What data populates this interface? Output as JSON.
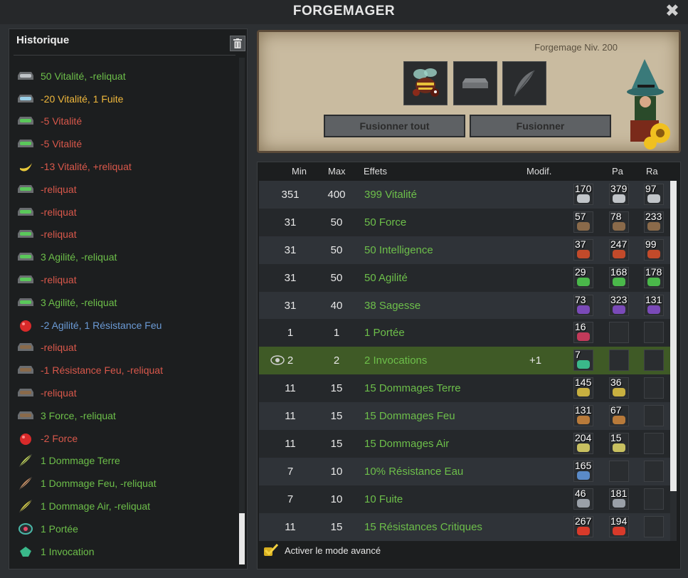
{
  "window": {
    "title": "FORGEMAGER",
    "close_label": "✖"
  },
  "history": {
    "title": "Historique",
    "items": [
      {
        "text": "50 Vitalité, -reliquat",
        "color": "green",
        "icon": "gray-rune-icon"
      },
      {
        "text": "-20 Vitalité, 1 Fuite",
        "color": "orange",
        "icon": "blue-rune-icon"
      },
      {
        "text": "-5 Vitalité",
        "color": "red",
        "icon": "green-rune-icon"
      },
      {
        "text": "-5 Vitalité",
        "color": "red",
        "icon": "green-rune-icon"
      },
      {
        "text": "-13 Vitalité, +reliquat",
        "color": "red",
        "icon": "banana-rune-icon"
      },
      {
        "text": "-reliquat",
        "color": "red",
        "icon": "green-rune-icon"
      },
      {
        "text": "-reliquat",
        "color": "red",
        "icon": "green-rune-icon"
      },
      {
        "text": "-reliquat",
        "color": "red",
        "icon": "green-rune-icon"
      },
      {
        "text": "3 Agilité, -reliquat",
        "color": "green",
        "icon": "green-rune-icon"
      },
      {
        "text": "-reliquat",
        "color": "red",
        "icon": "green-rune-icon"
      },
      {
        "text": "3 Agilité, -reliquat",
        "color": "green",
        "icon": "green-rune-icon"
      },
      {
        "text": "-2 Agilité, 1 Résistance Feu",
        "color": "blue",
        "icon": "red-rune-icon"
      },
      {
        "text": "-reliquat",
        "color": "red",
        "icon": "brown-rune-icon"
      },
      {
        "text": "-1 Résistance Feu, -reliquat",
        "color": "red",
        "icon": "brown-rune-icon"
      },
      {
        "text": "-reliquat",
        "color": "red",
        "icon": "brown-rune-icon"
      },
      {
        "text": "3 Force, -reliquat",
        "color": "green",
        "icon": "brown-rune-icon"
      },
      {
        "text": "-2 Force",
        "color": "red",
        "icon": "red-rune-icon"
      },
      {
        "text": "1 Dommage Terre",
        "color": "green",
        "icon": "quill-green-icon"
      },
      {
        "text": "1 Dommage Feu, -reliquat",
        "color": "green",
        "icon": "quill-brown-icon"
      },
      {
        "text": "1 Dommage Air, -reliquat",
        "color": "green",
        "icon": "quill-yellow-icon"
      },
      {
        "text": "1 Portée",
        "color": "green",
        "icon": "eye-rune-icon"
      },
      {
        "text": "1 Invocation",
        "color": "green",
        "icon": "invoc-rune-icon"
      }
    ]
  },
  "forge": {
    "level_text": "Forgemage Niv. 200",
    "fuse_all_label": "Fusionner tout",
    "fuse_label": "Fusionner"
  },
  "table": {
    "headers": {
      "min": "Min",
      "max": "Max",
      "effects": "Effets",
      "modif": "Modif.",
      "pa": "Pa",
      "ra": "Ra"
    },
    "rows": [
      {
        "min": "351",
        "max": "400",
        "effect": "399 Vitalité",
        "modif": "",
        "p": "170",
        "pa": "379",
        "ra": "97",
        "rune_color": "#c0c4c8"
      },
      {
        "min": "31",
        "max": "50",
        "effect": "50 Force",
        "modif": "",
        "p": "57",
        "pa": "78",
        "ra": "233",
        "rune_color": "#8a6a4a"
      },
      {
        "min": "31",
        "max": "50",
        "effect": "50 Intelligence",
        "modif": "",
        "p": "37",
        "pa": "247",
        "ra": "99",
        "rune_color": "#c24a2a"
      },
      {
        "min": "31",
        "max": "50",
        "effect": "50 Agilité",
        "modif": "",
        "p": "29",
        "pa": "168",
        "ra": "178",
        "rune_color": "#4ab84a"
      },
      {
        "min": "31",
        "max": "40",
        "effect": "38 Sagesse",
        "modif": "",
        "p": "73",
        "pa": "323",
        "ra": "131",
        "rune_color": "#7a4ab8"
      },
      {
        "min": "1",
        "max": "1",
        "effect": "1 Portée",
        "modif": "",
        "p": "16",
        "pa": "",
        "ra": "",
        "rune_color": "#c23a5a"
      },
      {
        "min": "2",
        "max": "2",
        "effect": "2 Invocations",
        "modif": "+1",
        "p": "7",
        "pa": "",
        "ra": "",
        "rune_color": "#3ab88a"
      },
      {
        "min": "11",
        "max": "15",
        "effect": "15 Dommages Terre",
        "modif": "",
        "p": "145",
        "pa": "36",
        "ra": "",
        "rune_color": "#c8b040"
      },
      {
        "min": "11",
        "max": "15",
        "effect": "15 Dommages Feu",
        "modif": "",
        "p": "131",
        "pa": "67",
        "ra": "",
        "rune_color": "#b87a3a"
      },
      {
        "min": "11",
        "max": "15",
        "effect": "15 Dommages Air",
        "modif": "",
        "p": "204",
        "pa": "15",
        "ra": "",
        "rune_color": "#c8c060"
      },
      {
        "min": "7",
        "max": "10",
        "effect": "10% Résistance Eau",
        "modif": "",
        "p": "165",
        "pa": "",
        "ra": "",
        "rune_color": "#5a8ac8"
      },
      {
        "min": "7",
        "max": "10",
        "effect": "10 Fuite",
        "modif": "",
        "p": "46",
        "pa": "181",
        "ra": "",
        "rune_color": "#9aa0a8"
      },
      {
        "min": "11",
        "max": "15",
        "effect": "15 Résistances Critiques",
        "modif": "",
        "p": "267",
        "pa": "194",
        "ra": "",
        "rune_color": "#d83a2a"
      }
    ],
    "advanced_label": "Activer le mode avancé"
  }
}
